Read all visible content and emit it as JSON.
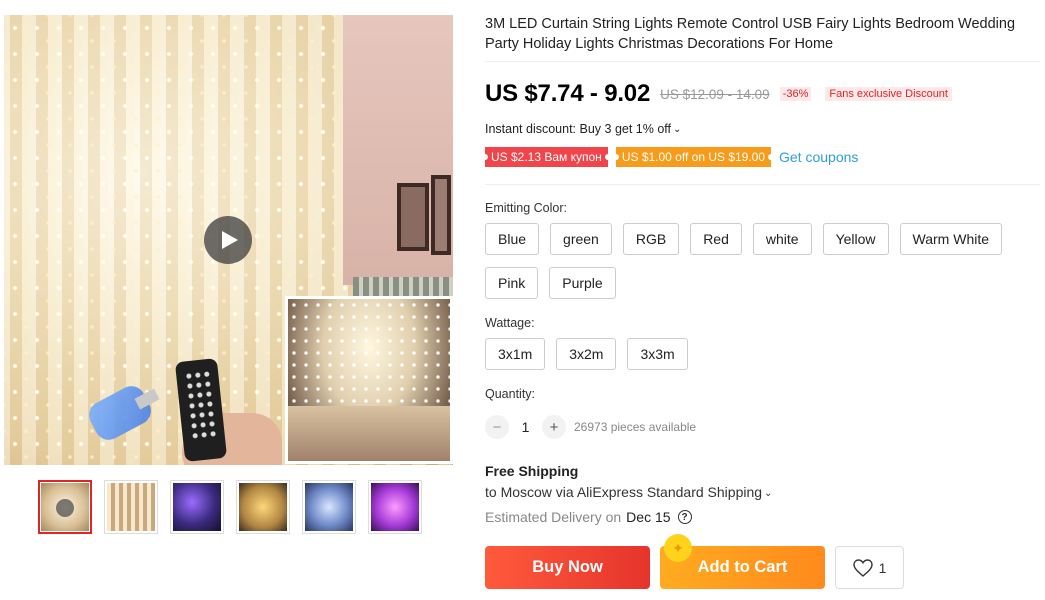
{
  "product": {
    "title": "3M LED Curtain String Lights Remote Control USB Fairy Lights Bedroom Wedding Party Holiday Lights Christmas Decorations For Home",
    "price": "US $7.74 - 9.02",
    "original_price": "US $12.09 - 14.09",
    "discount": "-36%",
    "fans_discount": "Fans exclusive Discount"
  },
  "promotions": {
    "instant_discount": "Instant discount: Buy 3 get 1% off",
    "coupon_1": "US $2.13 Вам купон",
    "coupon_2": "US $1.00 off on US $19.00",
    "get_coupons": "Get coupons"
  },
  "variants": {
    "color_label": "Emitting Color:",
    "colors": [
      "Blue",
      "green",
      "RGB",
      "Red",
      "white",
      "Yellow",
      "Warm White",
      "Pink",
      "Purple"
    ],
    "wattage_label": "Wattage:",
    "wattages": [
      "3x1m",
      "3x2m",
      "3x3m"
    ]
  },
  "quantity": {
    "label": "Quantity:",
    "minus": "−",
    "value": "1",
    "plus": "+",
    "available": "26973 pieces available"
  },
  "shipping": {
    "title": "Free Shipping",
    "destination": "to Moscow via AliExpress Standard Shipping",
    "delivery_label": "Estimated Delivery on",
    "delivery_date": "Dec 15",
    "help_glyph": "?"
  },
  "actions": {
    "buy_now": "Buy Now",
    "add_to_cart": "Add to Cart",
    "wishlist_count": "1"
  },
  "gallery": {
    "thumbnail_count": 6,
    "active_index": 0
  },
  "colors": {
    "price_red": "#e02525",
    "buy_button": "#ff4b33",
    "cart_button": "#ff9a1e",
    "link_blue": "#2e9fd8"
  },
  "icons": [
    "play-icon",
    "chevron-down-icon",
    "help-icon",
    "heart-icon",
    "sparkle-icon"
  ]
}
